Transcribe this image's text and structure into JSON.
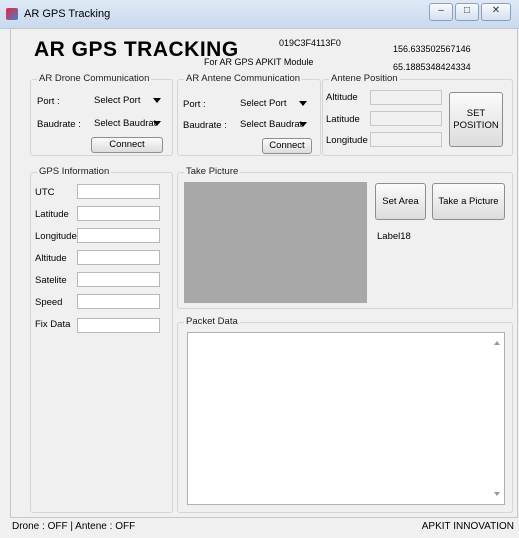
{
  "window": {
    "title": "AR GPS Tracking"
  },
  "header": {
    "title": "AR GPS TRACKING",
    "subtitle": "For AR GPS APKIT Module",
    "device_id": "019C3F4113F0",
    "coord_lat": "156.633502567146",
    "coord_lon": "65.1885348424334"
  },
  "drone_comm": {
    "title": "AR Drone Communication",
    "port_label": "Port :",
    "port_value": "Select Port",
    "baud_label": "Baudrate :",
    "baud_value": "Select Baudrat",
    "connect_label": "Connect"
  },
  "antenna_comm": {
    "title": "AR Antene Communication",
    "port_label": "Port :",
    "port_value": "Select Port",
    "baud_label": "Baudrate :",
    "baud_value": "Select Baudrat",
    "connect_label": "Connect"
  },
  "antenna_position": {
    "title": "Antene Position",
    "altitude_label": "Altitude",
    "latitude_label": "Latitude",
    "longitude_label": "Longitude",
    "set_label": "SET POSITION"
  },
  "gps_info": {
    "title": "GPS Information",
    "fields": [
      {
        "label": "UTC"
      },
      {
        "label": "Latitude"
      },
      {
        "label": "Longitude"
      },
      {
        "label": "Altitude"
      },
      {
        "label": "Satelite"
      },
      {
        "label": "Speed"
      },
      {
        "label": "Fix Data"
      }
    ]
  },
  "take_picture": {
    "title": "Take Picture",
    "set_area_label": "Set Area",
    "take_label": "Take a Picture",
    "status_label": "Label18"
  },
  "packet_data": {
    "title": "Packet Data"
  },
  "statusbar": {
    "left": "Drone : OFF | Antene : OFF",
    "right": "APKIT INNOVATION"
  },
  "colors": {
    "picture_area": "#a8a8a8",
    "window_bg": "#f0f0f0"
  }
}
